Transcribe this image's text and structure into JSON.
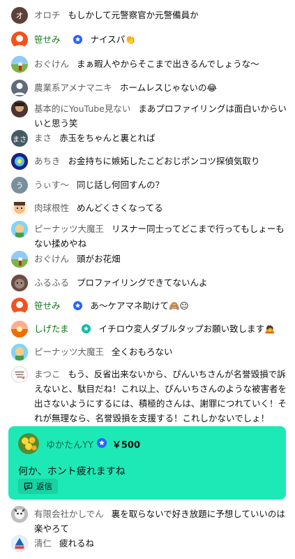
{
  "messages": [
    {
      "author": "オロチ",
      "text": "もしかして元警察官か元警備員か",
      "avatar": "オ"
    },
    {
      "author": "笹せみ",
      "text": "ナイスパ👏",
      "member": true
    },
    {
      "author": "おぐけん",
      "text": "まぁ暇人やからそこまで出きるんでしょうな〜"
    },
    {
      "author": "農業系アメナマニキ",
      "text": "ホームレスじゃないの😂"
    },
    {
      "author": "基本的にYouTube見ない",
      "text": "まあプロファイリングは面白いからいいと思う笑"
    },
    {
      "author": "まさ",
      "text": "赤玉をちゃんと裏とれば",
      "avatar": "まさ"
    },
    {
      "author": "あちき",
      "text": "お金持ちに嫉妬したこどおじポンコツ探偵気取り"
    },
    {
      "author": "うぃす〜",
      "text": "同じ話し何回すんの？",
      "avatar": "う"
    },
    {
      "author": "肉球根性",
      "text": "めんどくさくなってる"
    },
    {
      "author": "ピーナッツ大魔王",
      "text": "リスナー同士ってどこまで行ってもしょーもない揉めやね"
    },
    {
      "author": "おぐけん",
      "text": "頭がお花畑"
    },
    {
      "author": "ふるふる",
      "text": "プロファイリングできてないんよ"
    },
    {
      "author": "笹せみ",
      "text": "あ〜ケアマネ助けて🙈😐",
      "member": true
    },
    {
      "author": "しげたま",
      "text": "イチロウ変人ダブルタップお願い致します🙇",
      "member": true
    },
    {
      "author": "ピーナッツ大魔王",
      "text": "全くおもろない"
    },
    {
      "author": "まつこ",
      "text": "もう、反省出来ないから、ぴんいちさんが名誉毀損で訴えないと、駄目だね！これ以上、ぴんいちさんのような被害者を出さないようにするには、積極的さんは、謝罪につれていく！それが無理なら、名誉毀損を支援する！これしかないでしょ！"
    },
    {
      "author": "有限会社かしでん",
      "text": "裏を取らないで好き放題に予想していいのは楽やろて"
    },
    {
      "author": "清仁",
      "text": "疲れるね"
    }
  ],
  "superchat": {
    "author": "ゆかたんYY",
    "amount": "￥500",
    "message": "何か、ホント疲れますね",
    "reply_label": "返信",
    "color": "#1de9b6"
  },
  "colors": {
    "member": "#107516",
    "author": "#606060",
    "moderator_badge": "#2962ff"
  }
}
